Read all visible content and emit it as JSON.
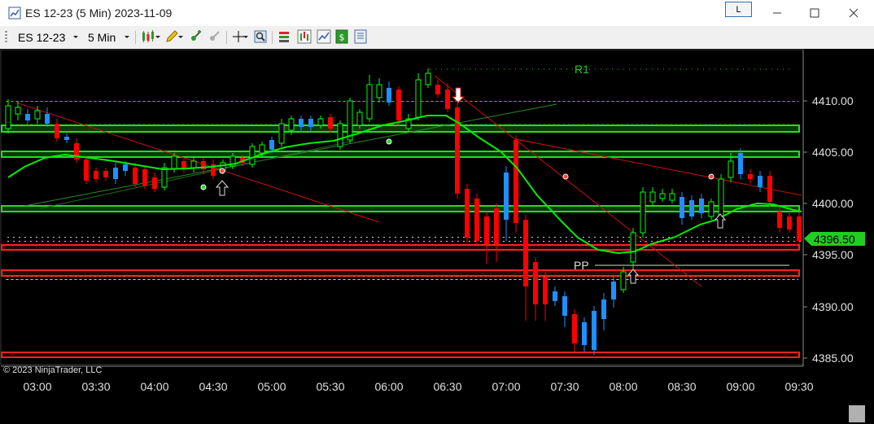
{
  "window": {
    "title": "ES 12-23 (5 Min)  2023-11-09",
    "link_label": "L"
  },
  "toolbar": {
    "instrument": "ES 12-23",
    "interval": "5 Min"
  },
  "chart": {
    "copyright": "© 2023 NinjaTrader, LLC",
    "price_axis": [
      "4410.00",
      "4405.00",
      "4400.00",
      "4395.00",
      "4390.00",
      "4385.00"
    ],
    "time_axis": [
      "03:00",
      "03:30",
      "04:00",
      "04:30",
      "05:00",
      "05:30",
      "06:00",
      "06:30",
      "07:00",
      "07:30",
      "08:00",
      "08:30",
      "09:00",
      "09:30"
    ],
    "last_price": "4396.50",
    "pivot_labels": {
      "r1": "R1",
      "pp": "PP"
    },
    "colors": {
      "background": "#000000",
      "up_candle": "#00ff00",
      "down_candle": "#ff0000",
      "accent_blue": "#1e90ff",
      "moving_average": "#00ee00",
      "zone_green": "#22dd22",
      "zone_red": "#ff2020",
      "trendline": "#cc1111"
    }
  }
}
